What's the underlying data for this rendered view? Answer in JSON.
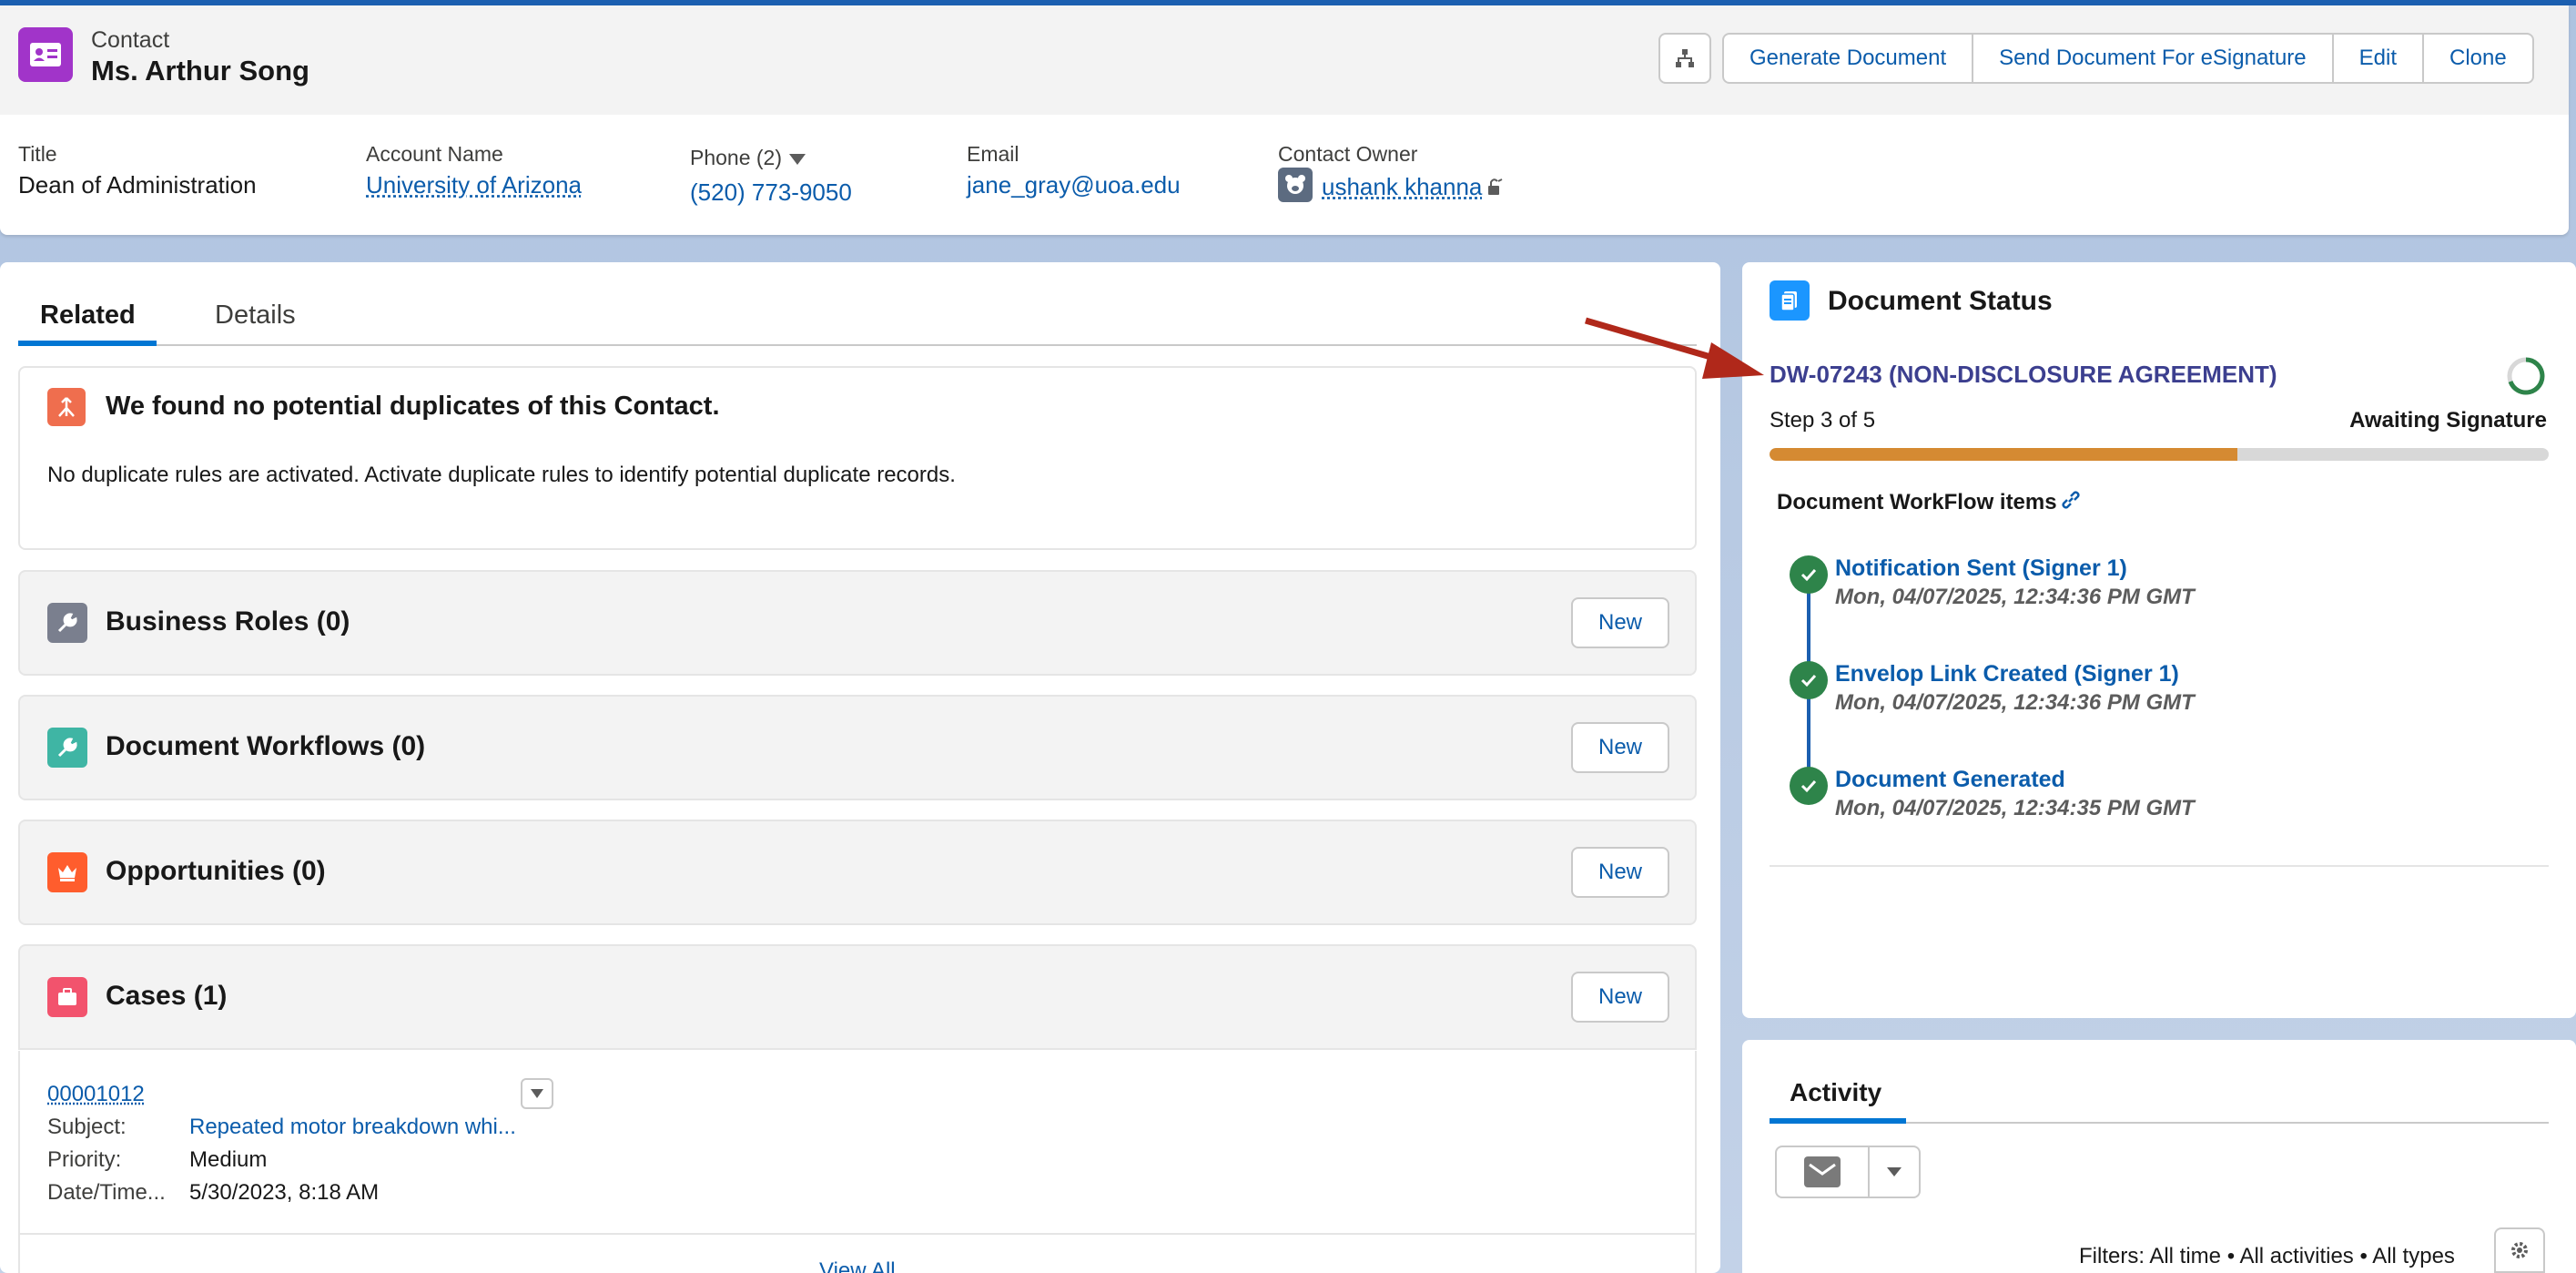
{
  "header": {
    "record_type": "Contact",
    "record_name": "Ms. Arthur Song",
    "actions": [
      "Generate Document",
      "Send Document For eSignature",
      "Edit",
      "Clone"
    ]
  },
  "fields": {
    "title_label": "Title",
    "title_value": "Dean of Administration",
    "account_label": "Account Name",
    "account_value": "University of Arizona",
    "phone_label": "Phone (2)",
    "phone_value": "(520) 773-9050",
    "email_label": "Email",
    "email_value": "jane_gray@uoa.edu",
    "owner_label": "Contact Owner",
    "owner_value": "ushank khanna"
  },
  "tabs": {
    "related": "Related",
    "details": "Details"
  },
  "duplicates": {
    "title": "We found no potential duplicates of this Contact.",
    "text": "No duplicate rules are activated. Activate duplicate rules to identify potential duplicate records."
  },
  "related_lists": {
    "new_label": "New",
    "business_roles": "Business Roles (0)",
    "document_workflows": "Document Workflows (0)",
    "opportunities": "Opportunities (0)",
    "cases": "Cases (1)"
  },
  "case": {
    "number": "00001012",
    "subject_label": "Subject:",
    "subject_value": "Repeated motor breakdown whi...",
    "priority_label": "Priority:",
    "priority_value": "Medium",
    "date_label": "Date/Time...",
    "date_value": "5/30/2023, 8:18 AM",
    "view_all": "View All"
  },
  "document_status": {
    "title": "Document Status",
    "doc_link": "DW-07243 (NON-DISCLOSURE AGREEMENT)",
    "step": "Step 3 of 5",
    "status": "Awaiting Signature",
    "progress": 0.6,
    "workflow_heading": "Document WorkFlow items",
    "items": [
      {
        "title": "Notification Sent (Signer 1)",
        "date": "Mon, 04/07/2025, 12:34:36 PM GMT"
      },
      {
        "title": "Envelop Link Created (Signer 1)",
        "date": "Mon, 04/07/2025, 12:34:36 PM GMT"
      },
      {
        "title": "Document Generated",
        "date": "Mon, 04/07/2025, 12:34:35 PM GMT"
      }
    ]
  },
  "activity": {
    "tab": "Activity",
    "filters": "Filters: All time • All activities • All types"
  },
  "colors": {
    "contact_icon": "#a134c9",
    "link": "#0b5cab",
    "progress": "#d58a32",
    "check": "#2e844a",
    "arrow": "#b0281a"
  }
}
